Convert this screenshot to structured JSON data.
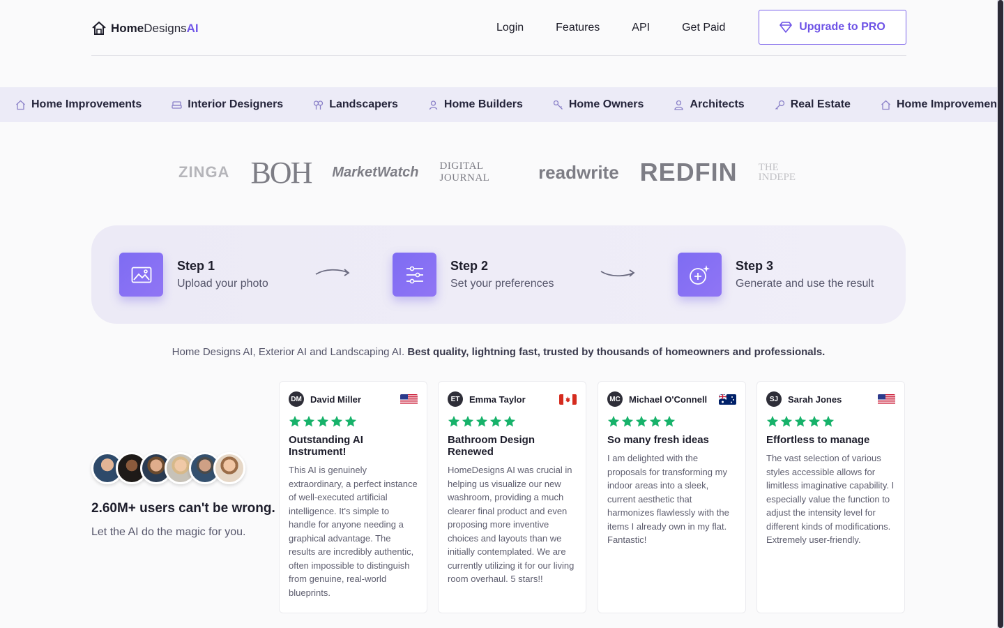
{
  "brand": {
    "home": "Home",
    "designs": "Designs",
    "ai": "AI"
  },
  "nav": {
    "login": "Login",
    "features": "Features",
    "api": "API",
    "get_paid": "Get Paid",
    "upgrade": "Upgrade to PRO"
  },
  "categories": [
    {
      "label": "Home Improvements",
      "icon": "house-icon"
    },
    {
      "label": "Interior Designers",
      "icon": "sofa-icon"
    },
    {
      "label": "Landscapers",
      "icon": "trees-icon"
    },
    {
      "label": "Home Builders",
      "icon": "builder-icon"
    },
    {
      "label": "Home Owners",
      "icon": "key-icon"
    },
    {
      "label": "Architects",
      "icon": "architect-icon"
    },
    {
      "label": "Real Estate",
      "icon": "search-key-icon"
    },
    {
      "label": "Home Improvements",
      "icon": "house-icon"
    }
  ],
  "press": {
    "zinga": "ZINGA",
    "boh": "BOH",
    "marketwatch": "MarketWatch",
    "digital_journal": "DIGITAL JOURNAL",
    "readwrite": "readwrite",
    "redfin": "REDFIN",
    "independent_1": "THE",
    "independent_2": "INDEPE"
  },
  "steps": [
    {
      "title": "Step 1",
      "text": "Upload your photo"
    },
    {
      "title": "Step 2",
      "text": "Set your preferences"
    },
    {
      "title": "Step 3",
      "text": "Generate and use the result"
    }
  ],
  "tagline": {
    "plain": "Home Designs AI, Exterior AI and Landscaping AI. ",
    "bold": "Best quality, lightning fast, trusted by thousands of homeowners and professionals."
  },
  "users": {
    "count_text": "2.60M+ users can't be wrong.",
    "sub": "Let the AI do the magic for you."
  },
  "reviews": [
    {
      "initials": "DM",
      "name": "David Miller",
      "flag": "us",
      "title": "Outstanding AI Instrument!",
      "body": "This AI is genuinely extraordinary, a perfect instance of well-executed artificial intelligence. It's simple to handle for anyone needing a graphical advantage. The results are incredibly authentic, often impossible to distinguish from genuine, real-world blueprints."
    },
    {
      "initials": "ET",
      "name": "Emma Taylor",
      "flag": "ca",
      "title": "Bathroom Design Renewed",
      "body": "HomeDesigns AI was crucial in helping us visualize our new washroom, providing a much clearer final product and even proposing more inventive choices and layouts than we initially contemplated. We are currently utilizing it for our living room overhaul. 5 stars!!"
    },
    {
      "initials": "MC",
      "name": "Michael O'Connell",
      "flag": "au",
      "title": "So many fresh ideas",
      "body": "I am delighted with the proposals for transforming my indoor areas into a sleek, current aesthetic that harmonizes flawlessly with the items I already own in my flat. Fantastic!"
    },
    {
      "initials": "SJ",
      "name": "Sarah Jones",
      "flag": "us",
      "title": "Effortless to manage",
      "body": "The vast selection of various styles accessible allows for limitless imaginative capability. I especially value the function to adjust the intensity level for different kinds of modifications. Extremely user-friendly."
    }
  ],
  "colors": {
    "accent": "#7157e8",
    "star": "#17b26a",
    "strip": "#ecebf7"
  }
}
